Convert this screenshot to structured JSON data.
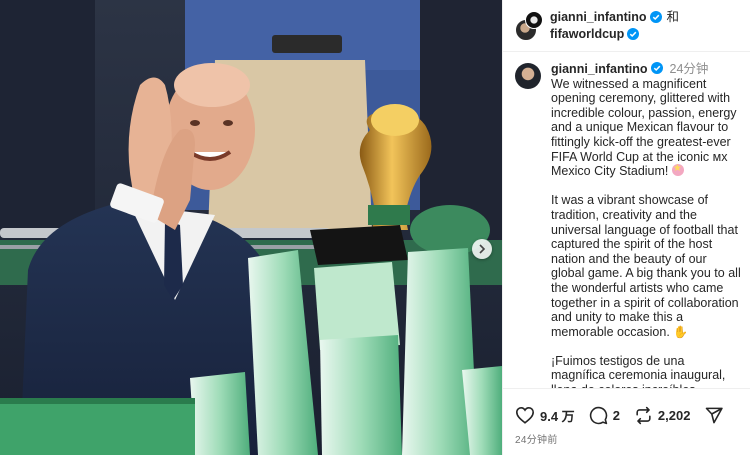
{
  "header": {
    "user1": "gianni_infantino",
    "connector": "和",
    "user2": "fifaworldcup"
  },
  "caption": {
    "username": "gianni_infantino",
    "time": "24分钟",
    "paragraph1": "We witnessed a magnificent opening ceremony, glittered with incredible colour, passion, energy and a unique Mexican flavour to fittingly kick-off the greatest-ever FIFA World Cup at the iconic ᴍx Mexico City Stadium!",
    "paragraph2": "It was a vibrant showcase of tradition, creativity and the universal language of football that captured the spirit of the host nation and the beauty of our global game. A big thank you to all the wonderful artists who came together in a spirit of collaboration and unity to make this a memorable occasion.",
    "paragraph3": "¡Fuimos testigos de una magnífica ceremonia inaugural, llena de colores increíbles, pasión, energía y"
  },
  "actions": {
    "likes": "9.4 万",
    "comments": "2",
    "reposts": "2,202"
  },
  "timestamp": "24分钟前",
  "icons": [
    "verified-badge-icon",
    "heart-icon",
    "comment-icon",
    "repost-icon",
    "share-icon",
    "chevron-right-icon"
  ],
  "colors": {
    "verified": "#0095f6",
    "trophy_gold": "#c9962c",
    "stand_green": "#5fb98a"
  }
}
